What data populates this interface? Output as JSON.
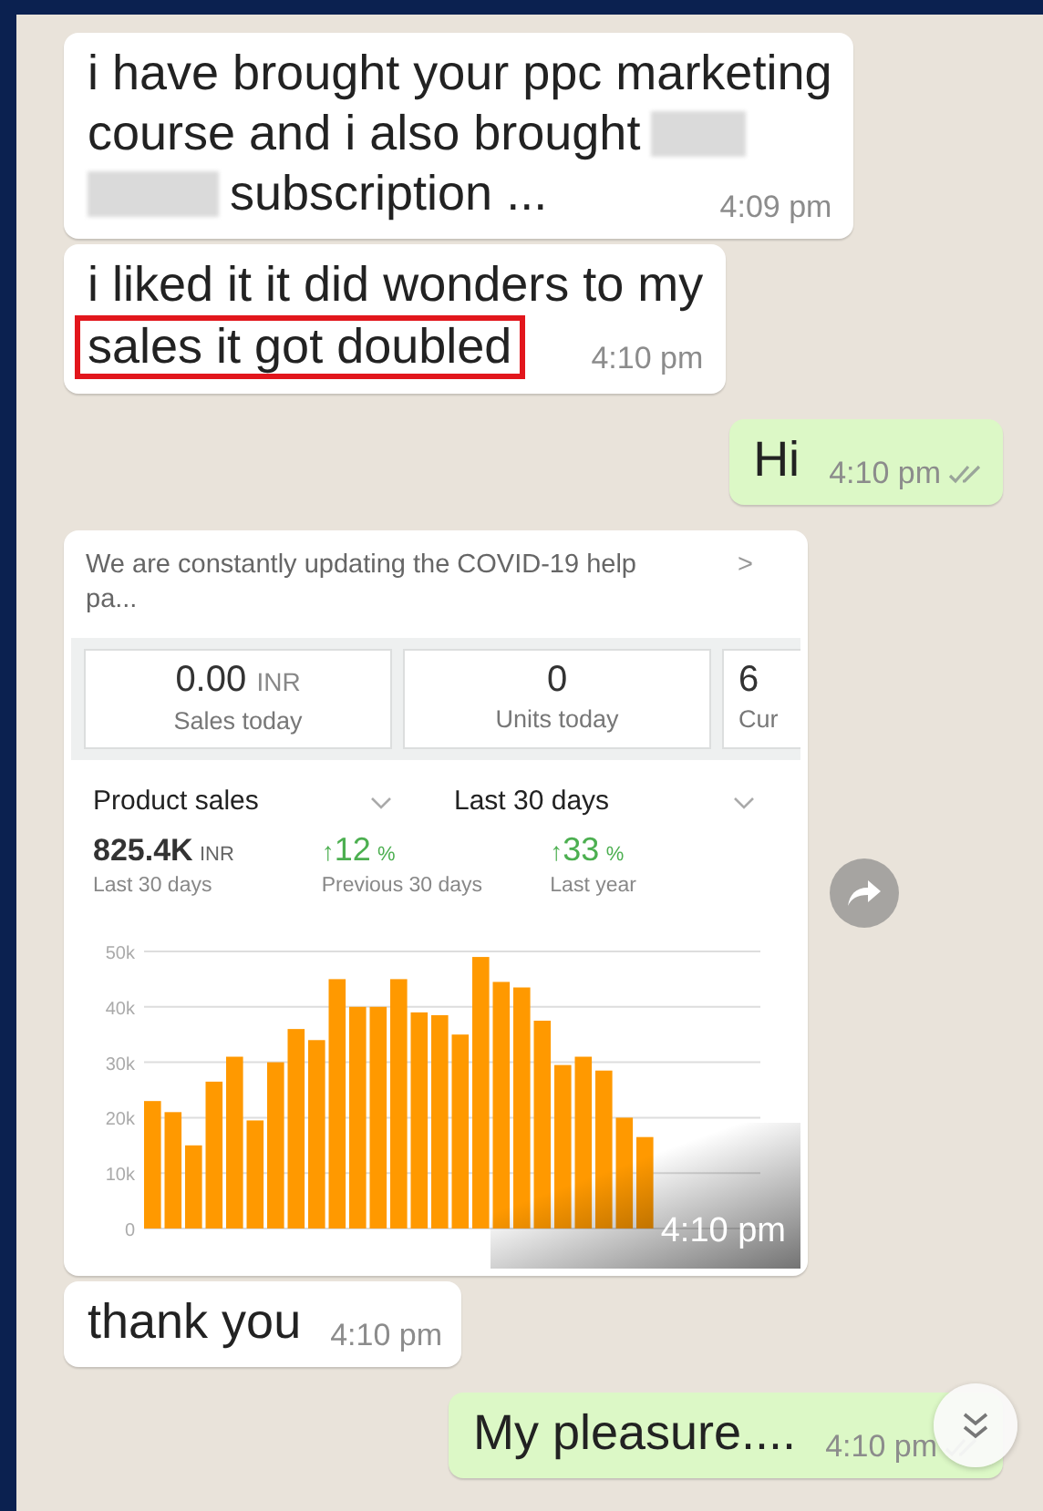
{
  "messages": [
    {
      "kind": "text",
      "outgoing": false,
      "lines": [
        [
          {
            "kind": "text",
            "text": "i have brought your ppc marketing",
            "highlighted": false
          }
        ],
        [
          {
            "kind": "text",
            "text": "course and i also brought",
            "highlighted": false
          },
          {
            "kind": "redaction"
          }
        ],
        [
          {
            "kind": "redaction"
          },
          {
            "kind": "text",
            "text": "subscription ...",
            "highlighted": false
          }
        ]
      ],
      "time": "4:09 pm"
    },
    {
      "kind": "text",
      "outgoing": false,
      "lines": [
        [
          {
            "kind": "text",
            "text": "i liked it it did wonders to my",
            "highlighted": false
          }
        ],
        [
          {
            "kind": "text",
            "text": "sales it got doubled",
            "highlighted": true
          }
        ]
      ],
      "time": "4:10 pm"
    },
    {
      "kind": "text",
      "outgoing": true,
      "lines": [
        [
          {
            "kind": "text",
            "text": "Hi",
            "highlighted": false
          }
        ]
      ],
      "time": "4:10 pm",
      "read": false
    },
    {
      "kind": "image",
      "outgoing": false,
      "time": "4:10 pm",
      "forward_button": true,
      "screenshot": {
        "banner": {
          "text": "We are constantly updating the COVID-19 help pa...",
          "chevron": ">"
        },
        "stats": [
          {
            "value": "0.00",
            "unit": "INR",
            "label": "Sales today"
          },
          {
            "value": "0",
            "label": "Units today"
          },
          {
            "value": "6",
            "label": "Cur"
          }
        ],
        "selectors": [
          {
            "label": "Product sales"
          },
          {
            "label": "Last 30 days"
          }
        ],
        "metrics": [
          {
            "value": "825.4K",
            "unit": "INR",
            "label": "Last 30 days",
            "up": false
          },
          {
            "arrow": "↑",
            "value": "12",
            "unit": "%",
            "label": "Previous 30 days",
            "up": true
          },
          {
            "arrow": "↑",
            "value": "33",
            "unit": "%",
            "label": "Last year",
            "up": true
          }
        ],
        "chart_data": {
          "type": "bar",
          "grid": true,
          "series": [
            {
              "color": "#ff9900",
              "values": [
                23000,
                21000,
                15000,
                26500,
                31000,
                19500,
                30000,
                36000,
                34000,
                45000,
                40000,
                40000,
                45000,
                39000,
                38500,
                35000,
                49000,
                44500,
                43500,
                37500,
                29500,
                31000,
                28500,
                20000,
                16500
              ]
            }
          ],
          "ylim": [
            0,
            50000
          ],
          "yticks": [
            {
              "value": 0,
              "label": "0"
            },
            {
              "value": 10000,
              "label": "10k"
            },
            {
              "value": 20000,
              "label": "20k"
            },
            {
              "value": 30000,
              "label": "30k"
            },
            {
              "value": 40000,
              "label": "40k"
            },
            {
              "value": 50000,
              "label": "50k"
            }
          ]
        }
      }
    },
    {
      "kind": "text",
      "outgoing": false,
      "lines": [
        [
          {
            "kind": "text",
            "text": "thank you",
            "highlighted": false
          }
        ]
      ],
      "time": "4:10 pm"
    },
    {
      "kind": "text",
      "outgoing": true,
      "lines": [
        [
          {
            "kind": "text",
            "text": "My pleasure....",
            "highlighted": false
          }
        ]
      ],
      "time": "4:10 pm",
      "read": false
    }
  ],
  "scroll_down_button": true
}
